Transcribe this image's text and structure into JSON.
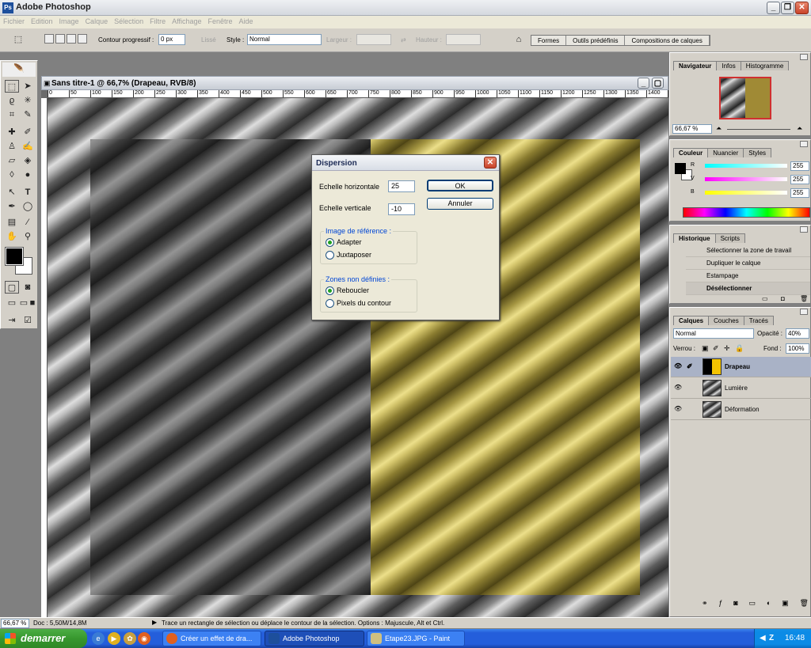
{
  "app": {
    "title": "Adobe Photoshop"
  },
  "menu": [
    "Fichier",
    "Edition",
    "Image",
    "Calque",
    "Sélection",
    "Filtre",
    "Affichage",
    "Fenêtre",
    "Aide"
  ],
  "options": {
    "contour_label": "Contour progressif :",
    "contour_value": "0 px",
    "lisse_label": "Lissé",
    "style_label": "Style :",
    "style_value": "Normal",
    "largeur_label": "Largeur :",
    "hauteur_label": "Hauteur :",
    "palette_well": [
      "Formes",
      "Outils prédéfinis",
      "Compositions de calques"
    ]
  },
  "document": {
    "title": "Sans titre-1 @ 66,7% (Drapeau, RVB/8)",
    "ruler_ticks": [
      "0",
      "50",
      "100",
      "150",
      "200",
      "250",
      "300",
      "350",
      "400",
      "450",
      "500",
      "550",
      "600",
      "650",
      "700",
      "750",
      "800",
      "850",
      "900",
      "950",
      "1000",
      "1050",
      "1100",
      "1150",
      "1200",
      "1250",
      "1300",
      "1350",
      "1400",
      "14"
    ]
  },
  "dialog": {
    "title": "Dispersion",
    "h_label": "Echelle horizontale",
    "h_value": "25",
    "v_label": "Echelle verticale",
    "v_value": "-10",
    "ok": "OK",
    "cancel": "Annuler",
    "ref_group": "Image de référence :",
    "ref_opt1": "Adapter",
    "ref_opt2": "Juxtaposer",
    "zones_group": "Zones non définies :",
    "zones_opt1": "Reboucler",
    "zones_opt2": "Pixels du contour"
  },
  "navigator": {
    "tabs": [
      "Navigateur",
      "Infos",
      "Histogramme"
    ],
    "zoom": "66,67 %"
  },
  "color": {
    "tabs": [
      "Couleur",
      "Nuancier",
      "Styles"
    ],
    "r_label": "R",
    "r_value": "255",
    "v_label": "V",
    "v_value": "255",
    "b_label": "B",
    "b_value": "255"
  },
  "history": {
    "tabs": [
      "Historique",
      "Scripts"
    ],
    "items": [
      "Sélectionner la zone de travail",
      "Dupliquer le calque",
      "Estampage",
      "Désélectionner"
    ]
  },
  "layers": {
    "tabs": [
      "Calques",
      "Couches",
      "Tracés"
    ],
    "blend_mode": "Normal",
    "opacity_label": "Opacité :",
    "opacity_value": "40%",
    "lock_label": "Verrou :",
    "fill_label": "Fond :",
    "fill_value": "100%",
    "items": [
      "Drapeau",
      "Lumière",
      "Déformation"
    ]
  },
  "status": {
    "zoom": "66,67 %",
    "doc": "Doc : 5,50M/14,8M",
    "message": "Trace un rectangle de sélection ou déplace le contour de la sélection. Options : Majuscule, Alt et Ctrl."
  },
  "taskbar": {
    "start": "demarrer",
    "tasks": [
      "Créer un effet de dra...",
      "Adobe Photoshop",
      "Etape23.JPG - Paint"
    ],
    "tray_letter": "Z",
    "clock": "16:48"
  }
}
